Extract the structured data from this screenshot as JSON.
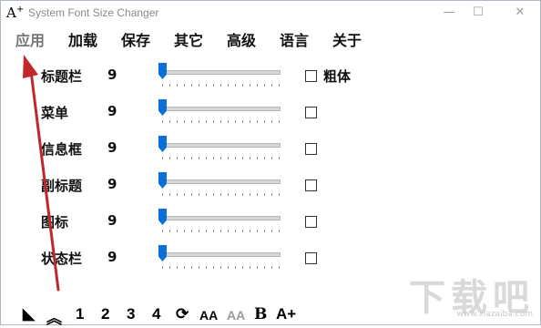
{
  "titlebar": {
    "icon_text": "A",
    "icon_sup": "+",
    "title": "System Font Size Changer",
    "minimize": "—",
    "maximize": "☐",
    "close": "✕"
  },
  "menu": [
    "应用",
    "加载",
    "保存",
    "其它",
    "高级",
    "语言",
    "关于"
  ],
  "rows": [
    {
      "label": "标题栏",
      "value": "9",
      "checkbox_label": "粗体",
      "slider": 0,
      "checked": false
    },
    {
      "label": "菜单",
      "value": "9",
      "slider": 0,
      "checked": false
    },
    {
      "label": "信息框",
      "value": "9",
      "slider": 0,
      "checked": false
    },
    {
      "label": "副标题",
      "value": "9",
      "slider": 0,
      "checked": false
    },
    {
      "label": "图标",
      "value": "9",
      "slider": 0,
      "checked": false
    },
    {
      "label": "状态栏",
      "value": "9",
      "slider": 0,
      "checked": false
    }
  ],
  "toolbar": {
    "contrast": "◣",
    "collapse": "︽",
    "preset1": "1",
    "preset2": "2",
    "preset3": "3",
    "preset4": "4",
    "refresh": "⟳",
    "font_a": "AA",
    "font_a_grey": "AA",
    "bold": "B",
    "font_plus": "A+"
  },
  "watermark": {
    "big": "下载吧",
    "small": "www.xiazaiba.com"
  },
  "colors": {
    "accent": "#0a70d6",
    "arrow": "#c0272d"
  },
  "icons": {
    "app": "font-size-icon",
    "minimize": "minimize-icon",
    "maximize": "maximize-icon",
    "close": "close-icon"
  }
}
